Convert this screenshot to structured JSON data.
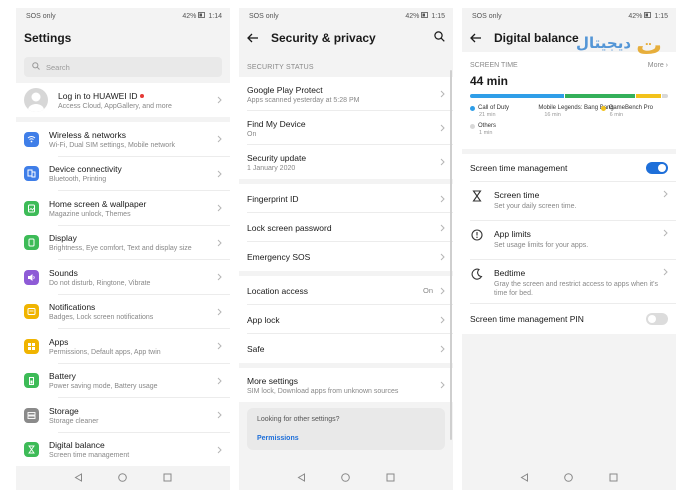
{
  "status": {
    "carrier": "SOS only",
    "battery": "42%",
    "time_left": "1:14",
    "time_mid": "1:15",
    "time_right": "1:15"
  },
  "settings": {
    "title": "Settings",
    "search_placeholder": "Search",
    "account": {
      "title": "Log in to HUAWEI ID",
      "subtitle": "Access Cloud, AppGallery, and more"
    },
    "items": [
      {
        "title": "Wireless & networks",
        "subtitle": "Wi-Fi, Dual SIM settings, Mobile network",
        "icon": "wifi-icon",
        "color": "#3f7ee8"
      },
      {
        "title": "Device connectivity",
        "subtitle": "Bluetooth, Printing",
        "icon": "device-connectivity-icon",
        "color": "#3f7ee8"
      },
      {
        "title": "Home screen & wallpaper",
        "subtitle": "Magazine unlock, Themes",
        "icon": "home-screen-icon",
        "color": "#3dbb57"
      },
      {
        "title": "Display",
        "subtitle": "Brightness, Eye comfort, Text and display size",
        "icon": "display-icon",
        "color": "#3dbb57"
      },
      {
        "title": "Sounds",
        "subtitle": "Do not disturb, Ringtone, Vibrate",
        "icon": "sound-icon",
        "color": "#8e5bd6"
      },
      {
        "title": "Notifications",
        "subtitle": "Badges, Lock screen notifications",
        "icon": "notifications-icon",
        "color": "#f0b400"
      },
      {
        "title": "Apps",
        "subtitle": "Permissions, Default apps, App twin",
        "icon": "apps-icon",
        "color": "#f0b400"
      },
      {
        "title": "Battery",
        "subtitle": "Power saving mode, Battery usage",
        "icon": "battery-icon",
        "color": "#3dbb57"
      },
      {
        "title": "Storage",
        "subtitle": "Storage cleaner",
        "icon": "storage-icon",
        "color": "#8a8a8a"
      },
      {
        "title": "Digital balance",
        "subtitle": "Screen time management",
        "icon": "digital-balance-icon",
        "color": "#3dbb57"
      }
    ]
  },
  "security": {
    "title": "Security & privacy",
    "section": "SECURITY STATUS",
    "group1": [
      {
        "title": "Google Play Protect",
        "subtitle": "Apps scanned yesterday at 5:28 PM"
      },
      {
        "title": "Find My Device",
        "subtitle": "On"
      },
      {
        "title": "Security update",
        "subtitle": "1 January 2020"
      }
    ],
    "group2": [
      {
        "title": "Fingerprint ID"
      },
      {
        "title": "Lock screen password"
      },
      {
        "title": "Emergency SOS"
      }
    ],
    "group3": [
      {
        "title": "Location access",
        "value": "On"
      },
      {
        "title": "App lock"
      },
      {
        "title": "Safe"
      }
    ],
    "more": {
      "title": "More settings",
      "subtitle": "SIM lock, Download apps from unknown sources"
    },
    "hint": {
      "text": "Looking for other settings?",
      "link": "Permissions"
    }
  },
  "digital_balance": {
    "title": "Digital balance",
    "screen_time_label": "SCREEN TIME",
    "more_label": "More",
    "total": "44 min",
    "segments": [
      {
        "name": "Call of Duty",
        "time": "21 min",
        "color": "#2f9ee8",
        "fraction": 0.48
      },
      {
        "name": "Mobile Legends: Bang Bang",
        "time": "16 min",
        "color": "#34b05a",
        "fraction": 0.36
      },
      {
        "name": "GameBench Pro",
        "time": "6 min",
        "color": "#f2c21b",
        "fraction": 0.13
      },
      {
        "name": "Others",
        "time": "1 min",
        "color": "#d8d8d8",
        "fraction": 0.03
      }
    ],
    "management": {
      "label": "Screen time management",
      "enabled": true
    },
    "rows": [
      {
        "title": "Screen time",
        "subtitle": "Set your daily screen time.",
        "icon": "hourglass-icon"
      },
      {
        "title": "App limits",
        "subtitle": "Set usage limits for your apps.",
        "icon": "timer-icon"
      },
      {
        "title": "Bedtime",
        "subtitle": "Gray the screen and restrict access to apps when it's time for bed.",
        "icon": "moon-icon"
      }
    ],
    "pin": {
      "label": "Screen time management PIN",
      "enabled": false
    }
  },
  "watermark": {
    "text": "ديجيتال",
    "logo": "ت"
  }
}
